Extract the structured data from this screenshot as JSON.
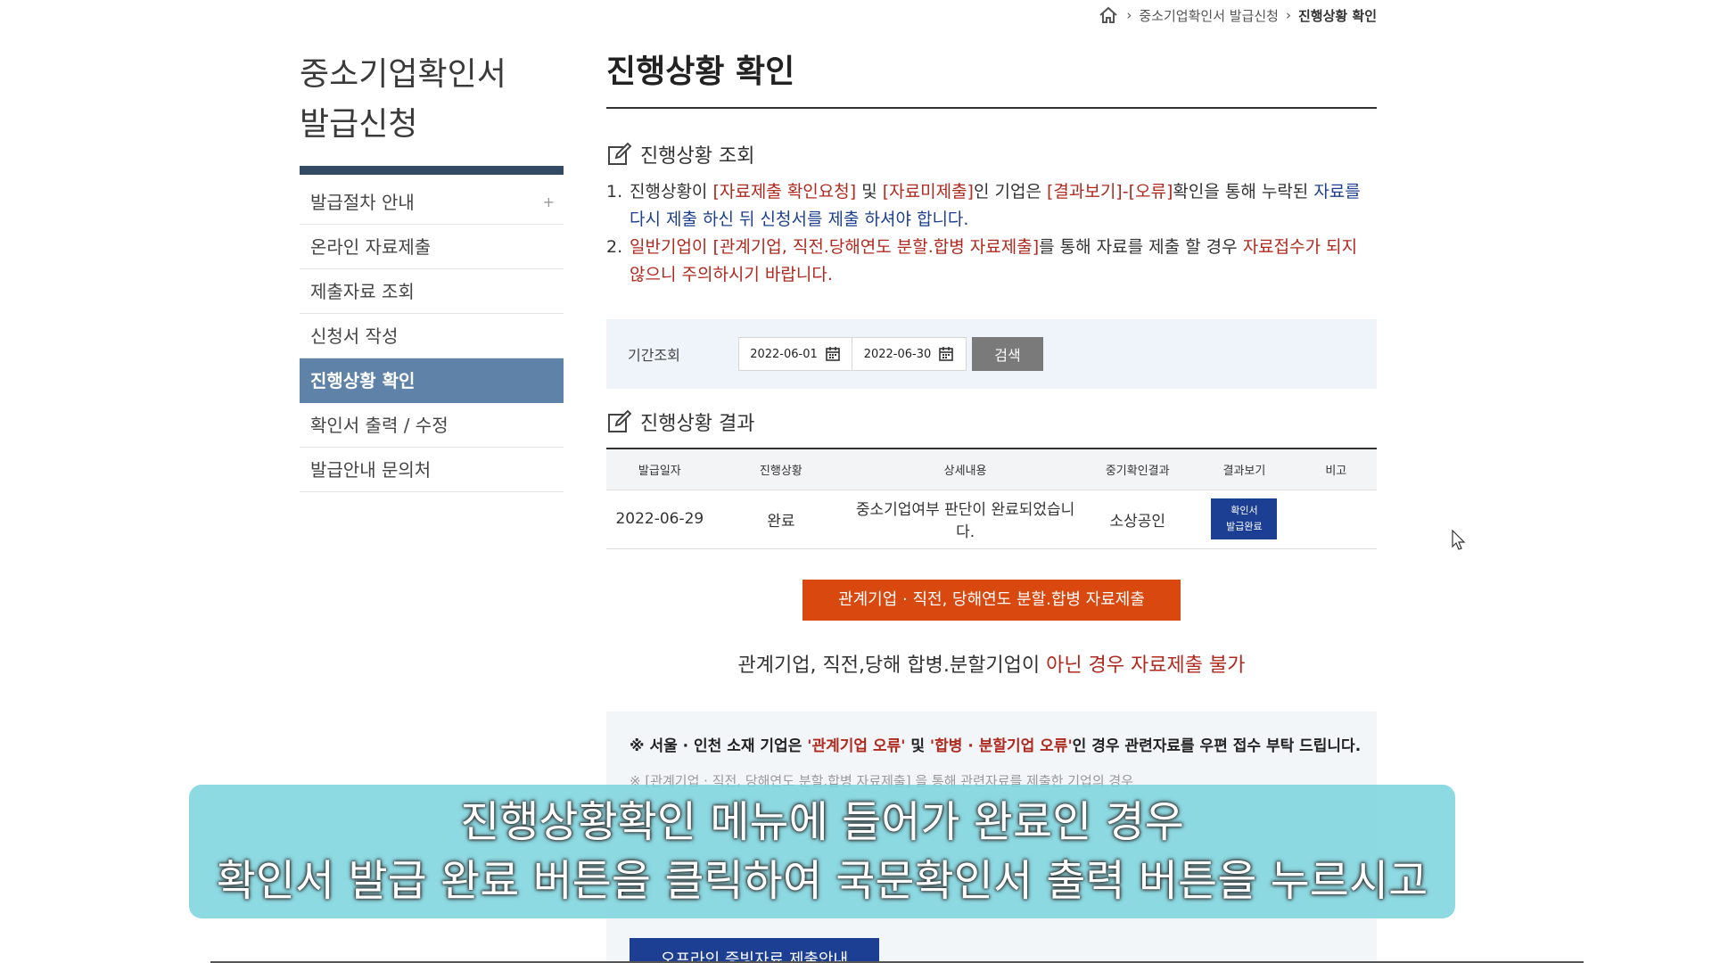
{
  "breadcrumb": {
    "home_icon": "home-icon",
    "items": [
      "중소기업확인서 발급신청",
      "진행상황 확인"
    ]
  },
  "sidebar": {
    "title": "중소기업확인서\n발급신청",
    "items": [
      {
        "label": "발급절차 안내",
        "expand": "+"
      },
      {
        "label": "온라인 자료제출"
      },
      {
        "label": "제출자료 조회"
      },
      {
        "label": "신청서 작성"
      },
      {
        "label": "진행상황 확인",
        "active": true
      },
      {
        "label": "확인서 출력 / 수정"
      },
      {
        "label": "발급안내 문의처"
      }
    ]
  },
  "main": {
    "title": "진행상황 확인",
    "inquiry_section_title": "진행상황 조회",
    "notes": [
      {
        "num": "1.",
        "parts": [
          {
            "text": "진행상황이 ",
            "style": ""
          },
          {
            "text": "[자료제출 확인요청]",
            "style": "red"
          },
          {
            "text": " 및 ",
            "style": ""
          },
          {
            "text": "[자료미제출]",
            "style": "red"
          },
          {
            "text": "인 기업은 ",
            "style": ""
          },
          {
            "text": "[결과보기]-[오류]",
            "style": "red"
          },
          {
            "text": "확인을 통해 누락된 ",
            "style": ""
          },
          {
            "text": "자료를 다시 제출 하신 뒤 신청서를 제출 하셔야 합니다.",
            "style": "blue"
          }
        ]
      },
      {
        "num": "2.",
        "parts": [
          {
            "text": "일반기업이 [관계기업, 직전.당해연도 분할.합병 자료제출]",
            "style": "red"
          },
          {
            "text": "를 통해 자료를 제출 할 경우 ",
            "style": ""
          },
          {
            "text": "자료접수가 되지 않으니 주의하시기 바랍니다.",
            "style": "red"
          }
        ]
      }
    ],
    "period": {
      "label": "기간조회",
      "start_date": "2022-06-01",
      "end_date": "2022-06-30",
      "calendar_icon": "calendar-icon",
      "search_label": "검색"
    },
    "result_section_title": "진행상황 결과",
    "table": {
      "headers": [
        "발급일자",
        "진행상황",
        "상세내용",
        "중기확인결과",
        "결과보기",
        "비고"
      ],
      "rows": [
        {
          "date": "2022-06-29",
          "status": "완료",
          "detail": "중소기업여부 판단이 완료되었습니다.",
          "result": "소상공인",
          "view_button_line1": "확인서",
          "view_button_line2": "발급완료",
          "remark": ""
        }
      ]
    },
    "orange_button": "관계기업 · 직전, 당해연도 분할.합병 자료제출",
    "note_line": {
      "normal": "관계기업, 직전,당해 합병.분할기업이 ",
      "red": "아닌 경우 자료제출 불가"
    },
    "info": {
      "line1_parts": [
        {
          "text": "※ 서울 · 인천 소재 기업은 ",
          "style": ""
        },
        {
          "text": "'관계기업 오류'",
          "style": "red"
        },
        {
          "text": " 및 ",
          "style": ""
        },
        {
          "text": "'합병 · 분할기업 오류'",
          "style": "red"
        },
        {
          "text": "인 경우 관련자료를 우편 접수 부탁 드립니다.",
          "style": ""
        }
      ],
      "faded_line": "※ [관계기업 · 직전, 당해연도 분할.합병 자료제출] 을 통해 관련자료를 제출한 기업의 경우",
      "offline_button": "오프라인 증빙자료 제출안내"
    }
  },
  "subtitle": {
    "line1": "진행상황확인 메뉴에 들어가 완료인 경우",
    "line2": "확인서 발급 완료 버튼을 클릭하여 국문확인서 출력 버튼을 누르시고"
  }
}
